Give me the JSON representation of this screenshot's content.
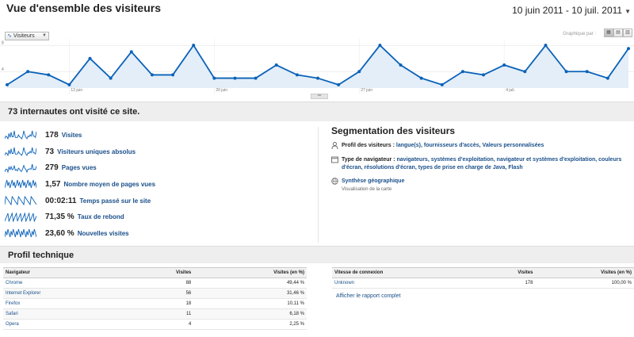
{
  "header": {
    "title": "Vue d'ensemble des visiteurs",
    "date_range": "10 juin 2011 - 10 juil. 2011"
  },
  "chart_controls": {
    "metric_label": "Visiteurs",
    "graph_by_label": "Graphique par :"
  },
  "chart_data": {
    "type": "area",
    "y_ticks": [
      "8",
      "4"
    ],
    "x_labels": [
      "13 juin",
      "20 juin",
      "27 juin",
      "4 juil."
    ],
    "x": [
      "10/06",
      "11/06",
      "12/06",
      "13/06",
      "14/06",
      "15/06",
      "16/06",
      "17/06",
      "18/06",
      "19/06",
      "20/06",
      "21/06",
      "22/06",
      "23/06",
      "24/06",
      "25/06",
      "26/06",
      "27/06",
      "28/06",
      "29/06",
      "30/06",
      "01/07",
      "02/07",
      "03/07",
      "04/07",
      "05/07",
      "06/07",
      "07/07",
      "08/07",
      "09/07",
      "10/07"
    ],
    "values": [
      2,
      4,
      3.5,
      2,
      6,
      3,
      7,
      3.5,
      3.5,
      8,
      3,
      3,
      3,
      5,
      3.5,
      3,
      2,
      4,
      8,
      5,
      3,
      2,
      4,
      3.5,
      5,
      4,
      8,
      4,
      4,
      3,
      7.5
    ],
    "ylim": [
      1.5,
      8.5
    ],
    "color": "#0b62b9",
    "fill": "#e3eef8"
  },
  "summary": {
    "headline": "73 internautes ont visité ce site.",
    "metrics": [
      {
        "value": "178",
        "label": "Visites"
      },
      {
        "value": "73",
        "label": "Visiteurs uniques absolus"
      },
      {
        "value": "279",
        "label": "Pages vues"
      },
      {
        "value": "1,57",
        "label": "Nombre moyen de pages vues"
      },
      {
        "value": "00:02:11",
        "label": "Temps passé sur le site"
      },
      {
        "value": "71,35 %",
        "label": "Taux de rebond"
      },
      {
        "value": "23,60 %",
        "label": "Nouvelles visites"
      }
    ]
  },
  "segmentation": {
    "title": "Segmentation des visiteurs",
    "profile_heading": "Profil des visiteurs :",
    "profile_links": [
      "langue(s)",
      "fournisseurs d'accès",
      "Valeurs personnalisées"
    ],
    "browser_heading": "Type de navigateur :",
    "browser_links": [
      "navigateurs",
      "systèmes d'exploitation",
      "navigateur et systèmes d'exploitation",
      "couleurs d'écran",
      "résolutions d'écran",
      "types de prise en charge de Java",
      "Flash"
    ],
    "geo_link": "Synthèse géographique",
    "geo_sub": "Visualisation de la carte"
  },
  "tech": {
    "title": "Profil technique",
    "browsers": {
      "headers": [
        "Navigateur",
        "Visites",
        "Visites (en %)"
      ],
      "rows": [
        [
          "Chrome",
          "88",
          "49,44 %"
        ],
        [
          "Internet Explorer",
          "56",
          "31,46 %"
        ],
        [
          "Firefox",
          "18",
          "10,11 %"
        ],
        [
          "Safari",
          "11",
          "6,18 %"
        ],
        [
          "Opera",
          "4",
          "2,25 %"
        ]
      ]
    },
    "speed": {
      "headers": [
        "Vitesse de connexion",
        "Visites",
        "Visites (en %)"
      ],
      "rows": [
        [
          "Unknown",
          "178",
          "100,00 %"
        ]
      ]
    },
    "report_link": "Afficher le rapport complet"
  }
}
